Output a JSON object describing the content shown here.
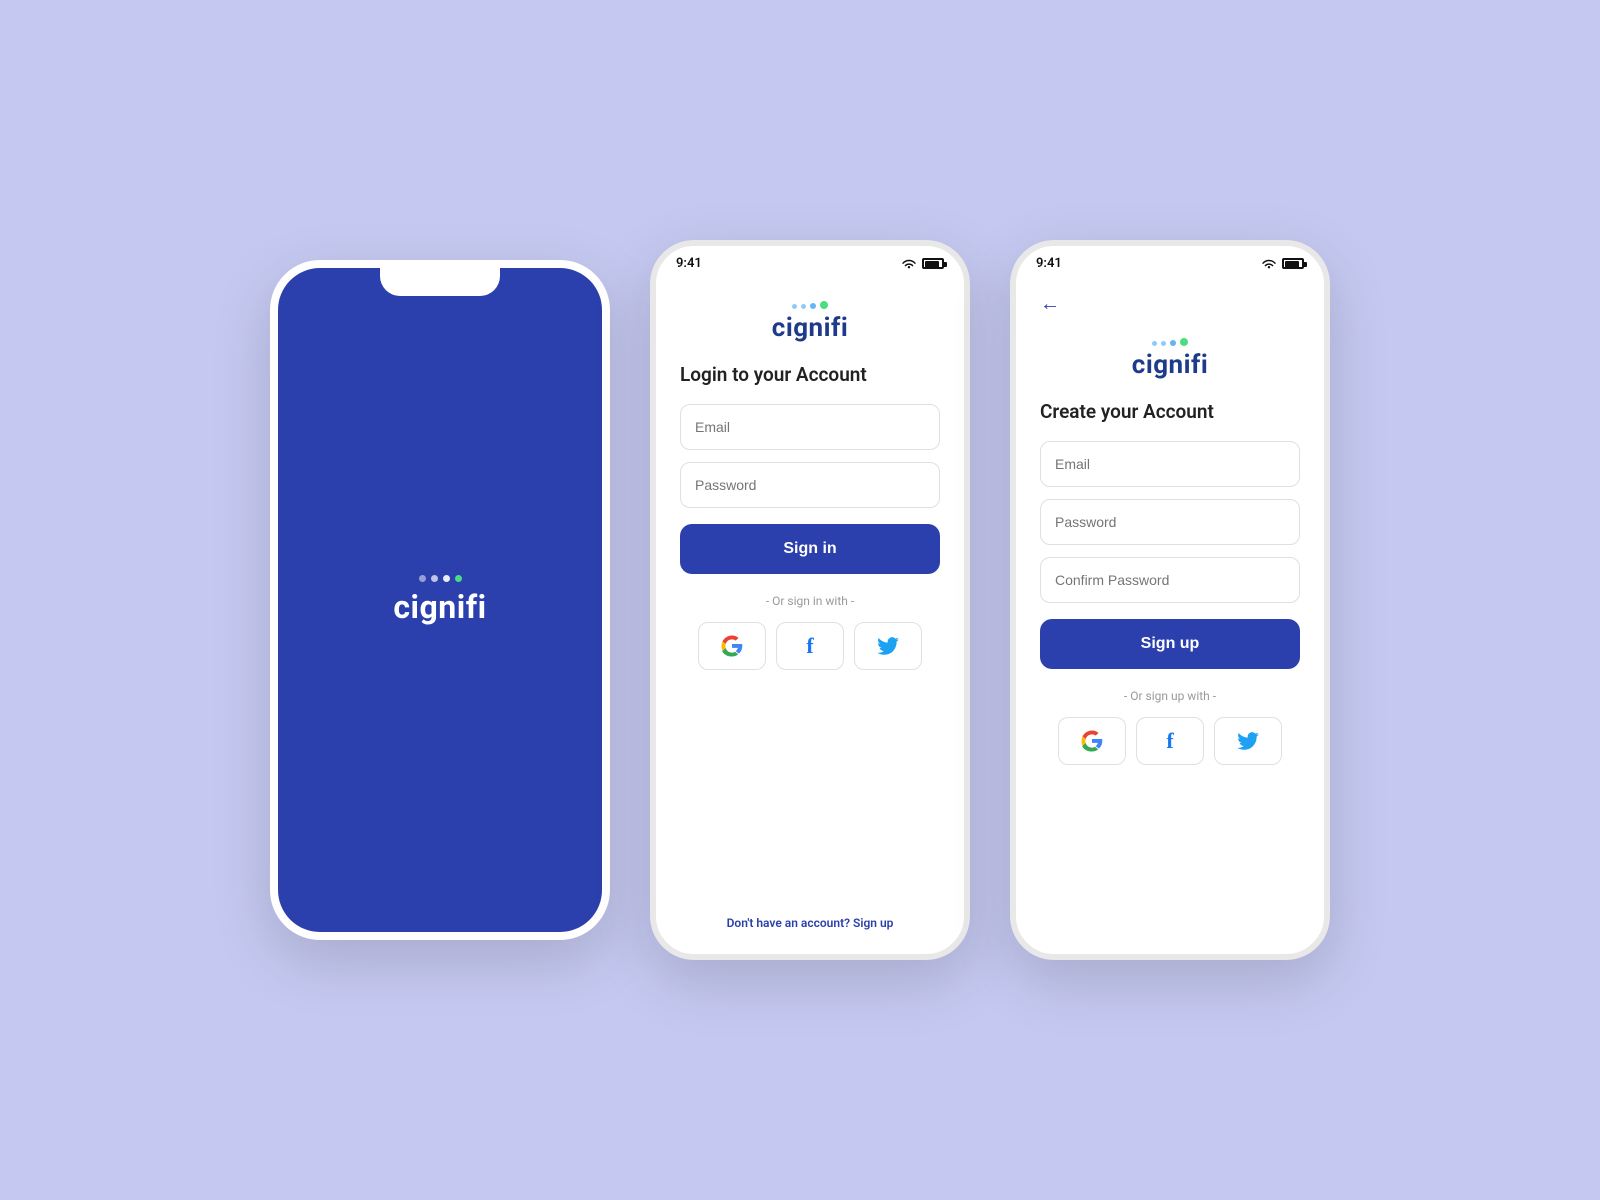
{
  "background": "#c5c8f0",
  "brand": {
    "color": "#2b3fad",
    "name": "cignifi"
  },
  "splash": {
    "logo": "cignifi"
  },
  "login": {
    "status_time": "9:41",
    "title": "Login to your Account",
    "email_placeholder": "Email",
    "password_placeholder": "Password",
    "sign_in_label": "Sign in",
    "divider_text": "- Or sign in with -",
    "bottom_text": "Don't have an account?",
    "sign_up_link": "Sign up"
  },
  "register": {
    "status_time": "9:41",
    "title": "Create your Account",
    "email_placeholder": "Email",
    "password_placeholder": "Password",
    "confirm_password_placeholder": "Confirm Password",
    "sign_up_label": "Sign up",
    "divider_text": "- Or sign up with -"
  }
}
